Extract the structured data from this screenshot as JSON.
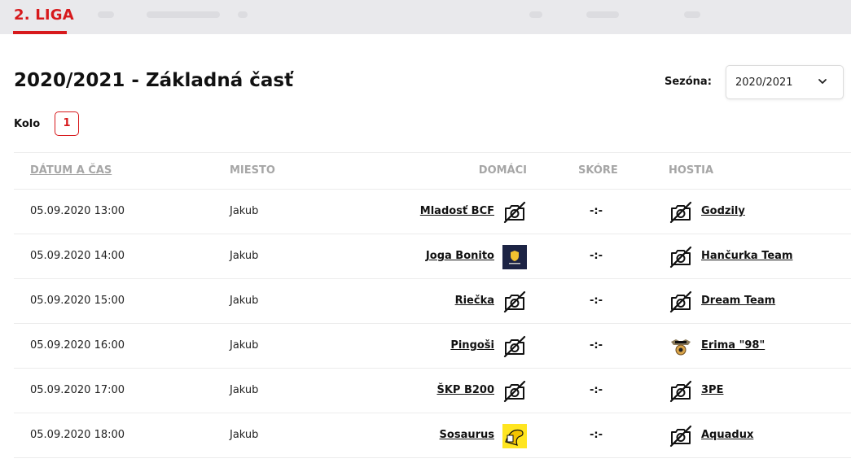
{
  "league": {
    "tab_label": "2. LIGA",
    "accent_color": "#d7191c"
  },
  "page": {
    "title": "2020/2021 - Základná časť"
  },
  "season": {
    "label": "Sezóna:",
    "selected": "2020/2021"
  },
  "round": {
    "label": "Kolo",
    "value": "1"
  },
  "table": {
    "headers": {
      "date": "DÁTUM A ČAS",
      "place": "MIESTO",
      "home": "DOMÁCI",
      "score": "SKÓRE",
      "away": "HOSTIA"
    },
    "rows": [
      {
        "date": "05.09.2020 13:00",
        "place": "Jakub",
        "home": "Mladosť BCF",
        "home_logo": "no-photo-icon",
        "score": "-:-",
        "away": "Godzily",
        "away_logo": "no-photo-icon"
      },
      {
        "date": "05.09.2020 14:00",
        "place": "Jakub",
        "home": "Joga Bonito",
        "home_logo": "team-logo-joga-bonito",
        "score": "-:-",
        "away": "Hančurka Team",
        "away_logo": "no-photo-icon"
      },
      {
        "date": "05.09.2020 15:00",
        "place": "Jakub",
        "home": "Riečka",
        "home_logo": "no-photo-icon",
        "score": "-:-",
        "away": "Dream Team",
        "away_logo": "no-photo-icon"
      },
      {
        "date": "05.09.2020 16:00",
        "place": "Jakub",
        "home": "Pingoši",
        "home_logo": "no-photo-icon",
        "score": "-:-",
        "away": "Erima \"98\"",
        "away_logo": "team-logo-erima"
      },
      {
        "date": "05.09.2020 17:00",
        "place": "Jakub",
        "home": "ŠKP B200",
        "home_logo": "no-photo-icon",
        "score": "-:-",
        "away": "3PE",
        "away_logo": "no-photo-icon"
      },
      {
        "date": "05.09.2020 18:00",
        "place": "Jakub",
        "home": "Sosaurus",
        "home_logo": "team-logo-sosaurus",
        "score": "-:-",
        "away": "Aquadux",
        "away_logo": "no-photo-icon"
      }
    ]
  }
}
